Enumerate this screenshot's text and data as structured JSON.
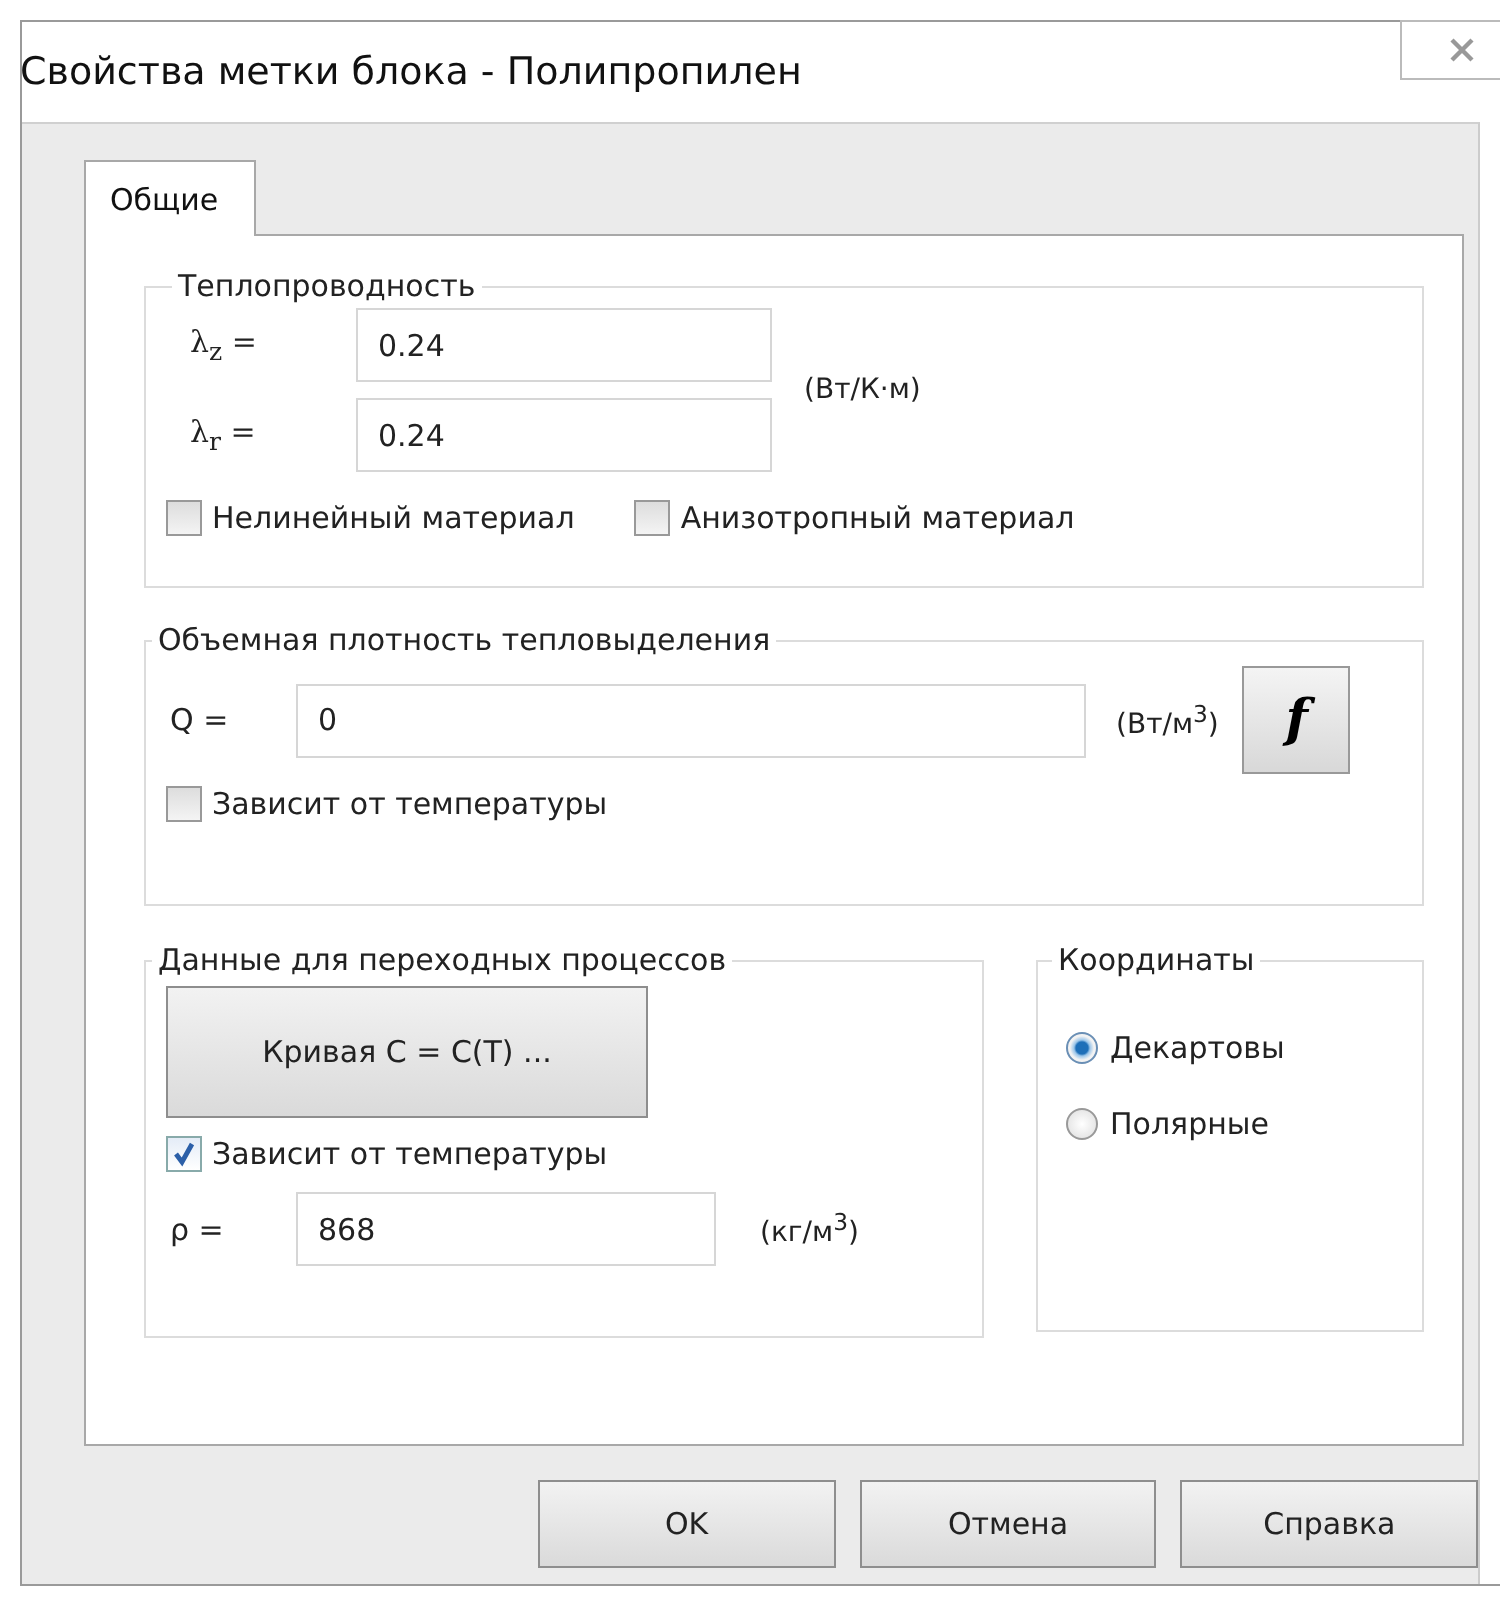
{
  "window": {
    "title": "Свойства метки блока - Полипропилен"
  },
  "tabs": [
    {
      "label": "Общие",
      "selected": true
    }
  ],
  "conductivity": {
    "title": "Теплопроводность",
    "fields": [
      {
        "label": "λ$_{z}$ =",
        "value": "0.24"
      },
      {
        "label": "λ$_{r}$ =",
        "value": "0.24"
      }
    ],
    "unit": "(Вт/К·м)",
    "checkboxes": [
      {
        "label": "Нелинейный материал",
        "checked": false
      },
      {
        "label": "Анизотропный материал",
        "checked": false
      }
    ]
  },
  "heat_source": {
    "title": "Объемная плотность тепловыделения",
    "label": "Q =",
    "value": "0",
    "unit": "(Вт/м$^{3}$)",
    "function_button": "f",
    "checkbox": {
      "label": "Зависит от температуры",
      "checked": false
    }
  },
  "transient": {
    "title": "Данные для переходных процессов",
    "curve_button": "Кривая C = C(T) ...",
    "checkbox": {
      "label": "Зависит от температуры",
      "checked": true
    },
    "label": "ρ =",
    "value": "868",
    "unit": "(кг/м$^{3}$)"
  },
  "coordinates": {
    "title": "Координаты",
    "options": [
      {
        "label": "Декартовы",
        "selected": true
      },
      {
        "label": "Полярные",
        "selected": false
      }
    ]
  },
  "buttons": [
    "OK",
    "Отмена",
    "Справка"
  ]
}
